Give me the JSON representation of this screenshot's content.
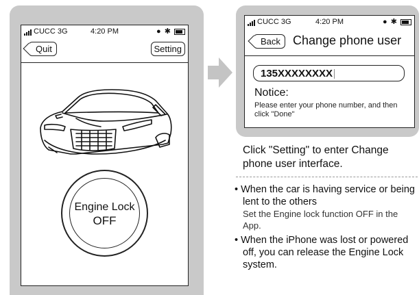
{
  "left_phone": {
    "status": {
      "carrier": "CUCC 3G",
      "time": "4:20 PM"
    },
    "quit_label": "Quit",
    "setting_label": "Setting",
    "engine_lock": {
      "label": "Engine Lock",
      "state": "OFF"
    }
  },
  "right_phone": {
    "status": {
      "carrier": "CUCC 3G",
      "time": "4:20 PM"
    },
    "back_label": "Back",
    "title": "Change phone user",
    "phone_value": "135XXXXXXXX",
    "notice_title": "Notice:",
    "notice_body": "Please enter your phone number, and then click \"Done\""
  },
  "instruction": "Click \"Setting\" to enter Change phone user interface.",
  "bullets": [
    {
      "lead": "When the car is having service or being lent to the others",
      "sub": "Set the Engine lock function OFF in the App."
    },
    {
      "lead": "When the iPhone was lost or powered off, you can release  the Engine Lock system.",
      "sub": ""
    }
  ],
  "icons": [
    "signal-icon",
    "moon-icon",
    "bluetooth-icon",
    "battery-icon",
    "car-illustration",
    "arrow-icon"
  ],
  "colors": {
    "frame": "#c9c9c9",
    "arrow": "#c4c4c4"
  }
}
